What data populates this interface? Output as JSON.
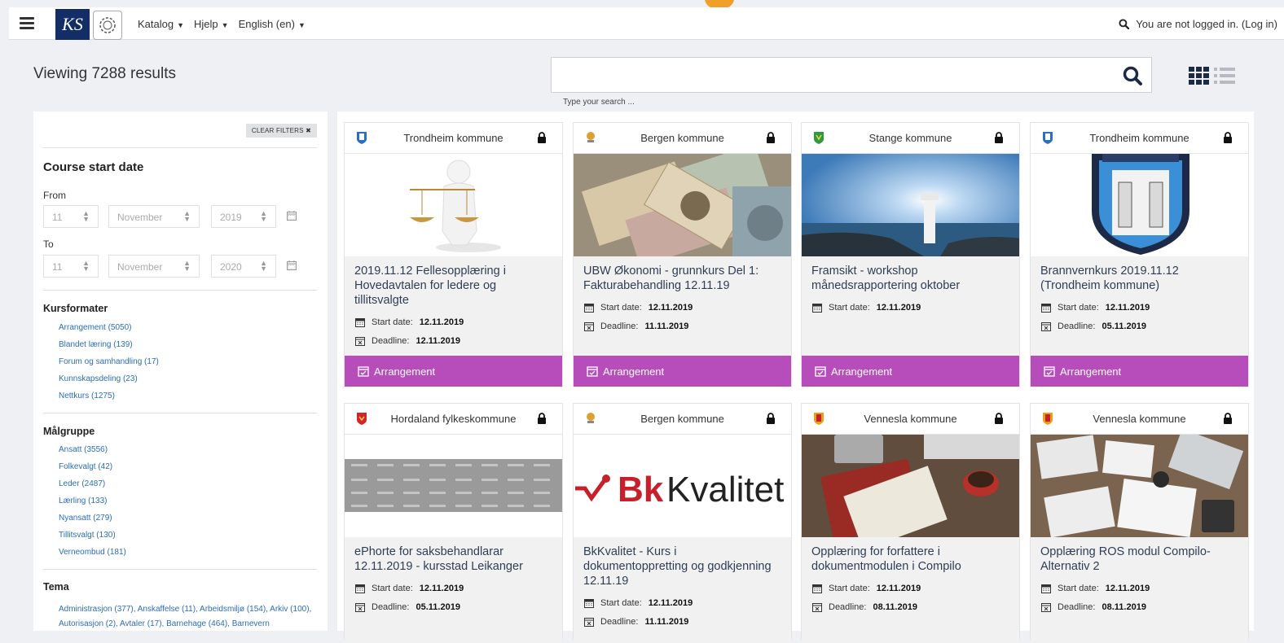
{
  "nav": {
    "menu": [
      {
        "label": "Katalog"
      },
      {
        "label": "Hjelp"
      },
      {
        "label": "English (en)"
      }
    ],
    "login_status": "You are not logged in. (",
    "login_link": "Log in",
    "login_close": ")"
  },
  "header": {
    "viewing": "Viewing 7288 results",
    "search_placeholder": "",
    "search_hint": "Type your search ..."
  },
  "sidebar": {
    "clear_filters": "CLEAR FILTERS",
    "course_start_title": "Course start date",
    "from_label": "From",
    "to_label": "To",
    "from": {
      "day": "11",
      "month": "November",
      "year": "2019"
    },
    "to": {
      "day": "11",
      "month": "November",
      "year": "2020"
    },
    "kursformater_title": "Kursformater",
    "kursformater": [
      "Arrangement (5050)",
      "Blandet læring (139)",
      "Forum og samhandling (17)",
      "Kunnskapsdeling (23)",
      "Nettkurs (1275)"
    ],
    "malgruppe_title": "Målgruppe",
    "malgruppe": [
      "Ansatt (3556)",
      "Folkevalgt (42)",
      "Leder (2487)",
      "Lærling (133)",
      "Nyansatt (279)",
      "Tillitsvalgt (130)",
      "Verneombud (181)"
    ],
    "tema_title": "Tema",
    "tema_text": "Administrasjon (377), Anskaffelse (11), Arbeidsmiljø (154), Arkiv (100), Autorisasjon (2), Avtaler (17), Barnehage (464), Barnevern"
  },
  "cards": [
    {
      "org": "Trondheim kommune",
      "title": "2019.11.12 Fellesopplæring i Hovedavtalen for ledere og tillitsvalgte",
      "start_label": "Start date:",
      "start": "12.11.2019",
      "deadline_label": "Deadline:",
      "deadline": "12.11.2019",
      "badge": "Arrangement"
    },
    {
      "org": "Bergen kommune",
      "title": "UBW Økonomi - grunnkurs Del 1: Fakturabehandling 12.11.19",
      "start_label": "Start date:",
      "start": "12.11.2019",
      "deadline_label": "Deadline:",
      "deadline": "11.11.2019",
      "badge": "Arrangement"
    },
    {
      "org": "Stange kommune",
      "title": "Framsikt - workshop månedsrapportering oktober",
      "start_label": "Start date:",
      "start": "12.11.2019",
      "badge": "Arrangement"
    },
    {
      "org": "Trondheim kommune",
      "title": "Brannvernkurs 2019.11.12 (Trondheim kommune)",
      "start_label": "Start date:",
      "start": "12.11.2019",
      "deadline_label": "Deadline:",
      "deadline": "05.11.2019",
      "badge": "Arrangement"
    },
    {
      "org": "Hordaland fylkeskommune",
      "title": "ePhorte for saksbehandlarar 12.11.2019 - kursstad Leikanger",
      "start_label": "Start date:",
      "start": "12.11.2019",
      "deadline_label": "Deadline:",
      "deadline": "05.11.2019"
    },
    {
      "org": "Bergen kommune",
      "title": "BkKvalitet - Kurs i dokumentoppretting og godkjenning 12.11.19",
      "start_label": "Start date:",
      "start": "12.11.2019",
      "deadline_label": "Deadline:",
      "deadline": "11.11.2019",
      "logo_bk": "Bk",
      "logo_kvalitet": "Kvalitet"
    },
    {
      "org": "Vennesla kommune",
      "title": "Opplæring for forfattere i dokumentmodulen i Compilo",
      "start_label": "Start date:",
      "start": "12.11.2019",
      "deadline_label": "Deadline:",
      "deadline": "08.11.2019"
    },
    {
      "org": "Vennesla kommune",
      "title": "Opplæring ROS modul Compilo- Alternativ 2",
      "start_label": "Start date:",
      "start": "12.11.2019",
      "deadline_label": "Deadline:",
      "deadline": "08.11.2019"
    }
  ],
  "colors": {
    "badge": "#b64dbb",
    "brand": "#132d67",
    "link": "#2a6db5"
  }
}
